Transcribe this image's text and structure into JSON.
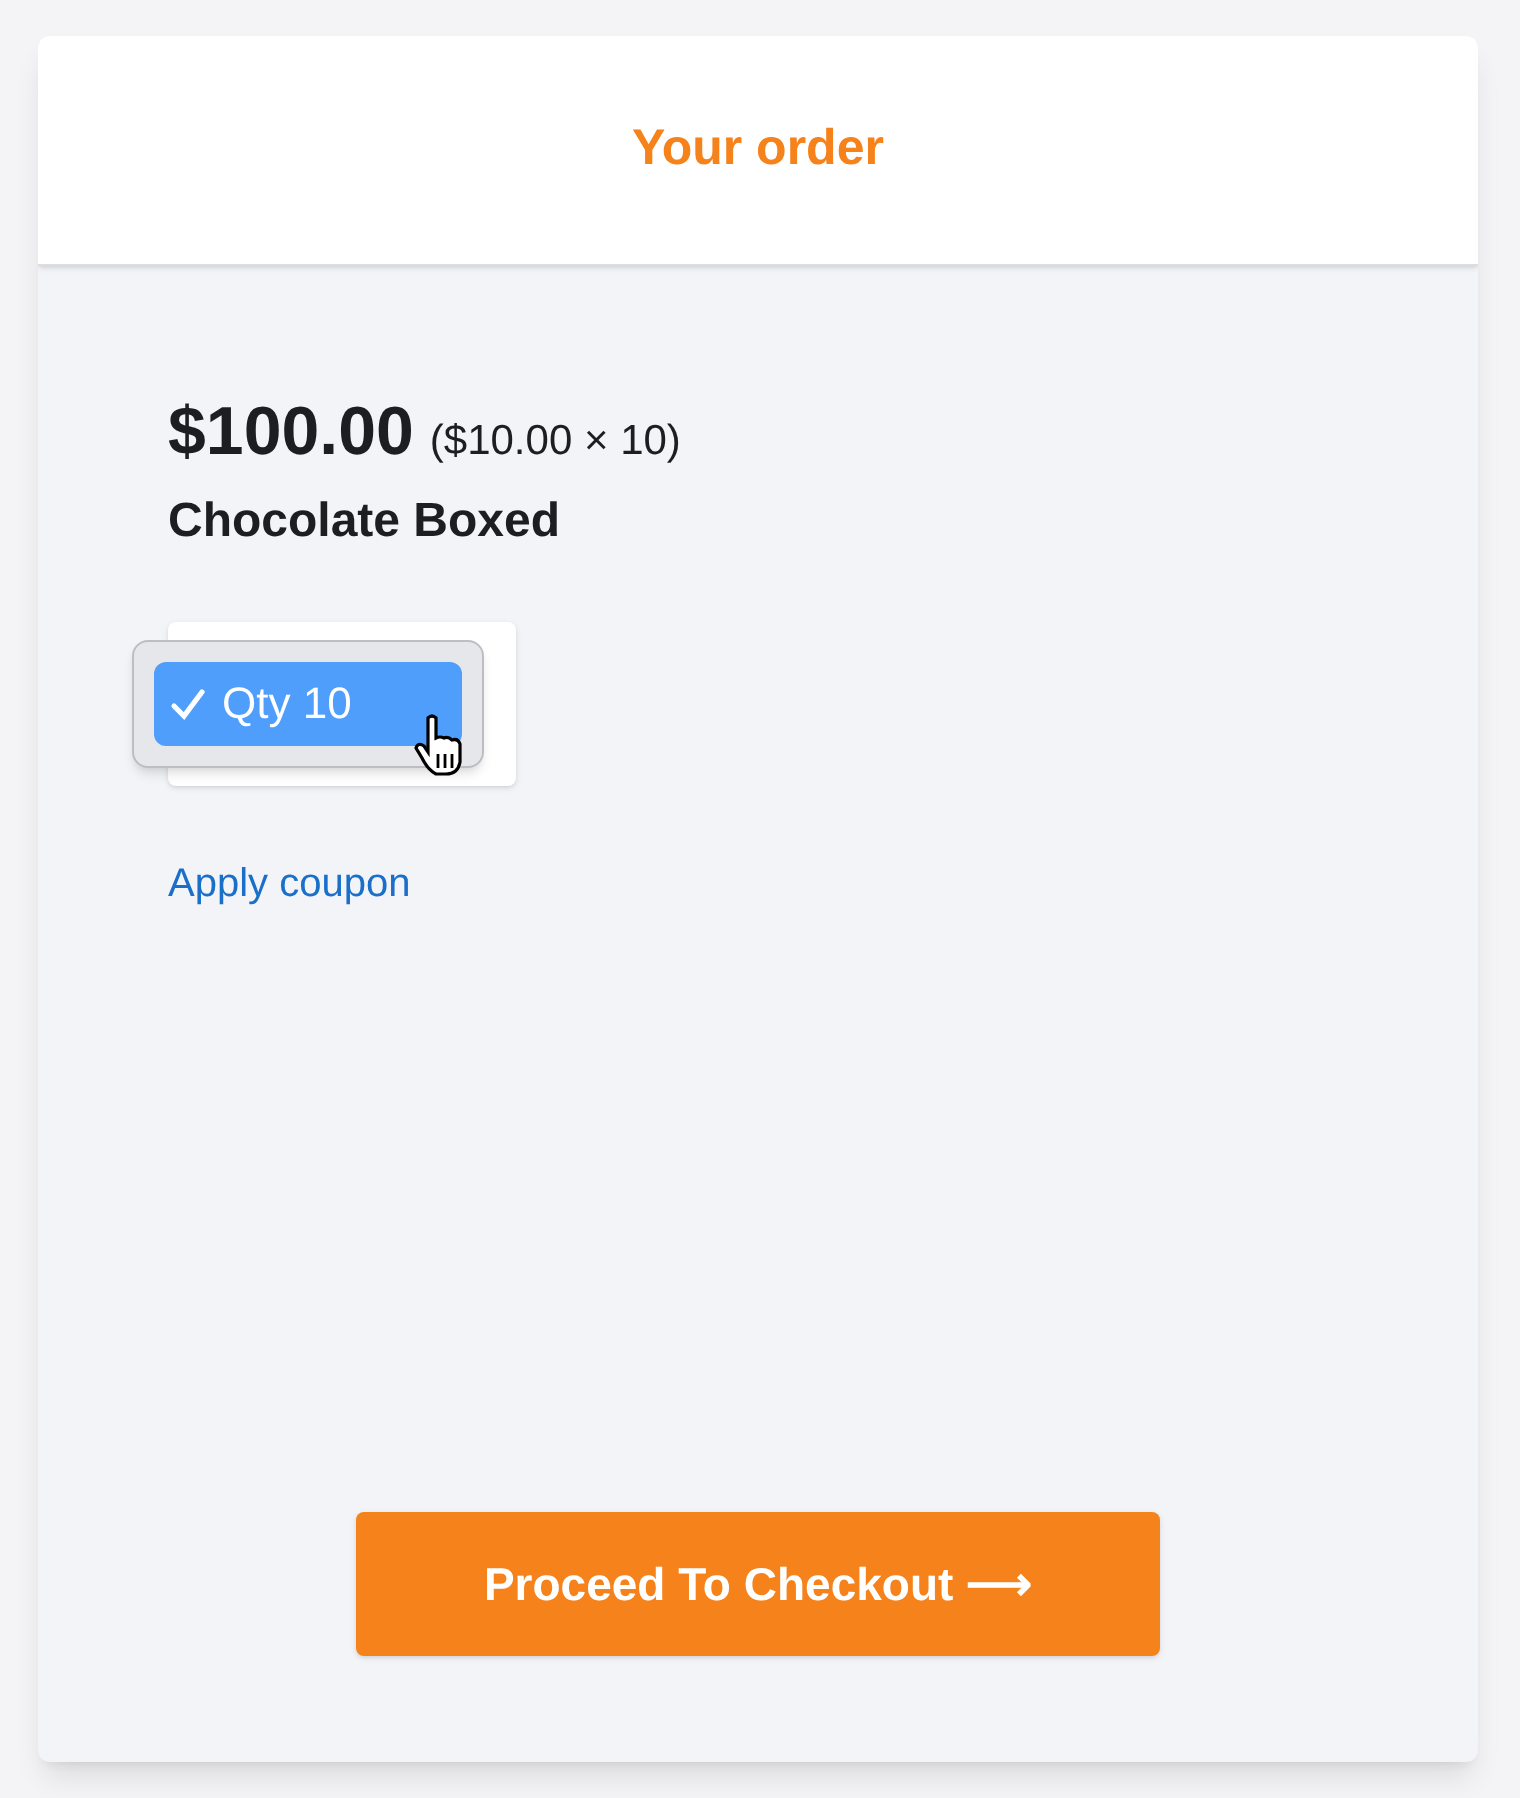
{
  "header": {
    "title": "Your order"
  },
  "item": {
    "total": "$100.00",
    "breakdown": "($10.00 × 10)",
    "name": "Chocolate Boxed"
  },
  "quantity_menu": {
    "options": [
      {
        "label": "Qty 10",
        "selected": true
      }
    ]
  },
  "coupon_link": "Apply coupon",
  "checkout_button": "Proceed To Checkout ⟶"
}
